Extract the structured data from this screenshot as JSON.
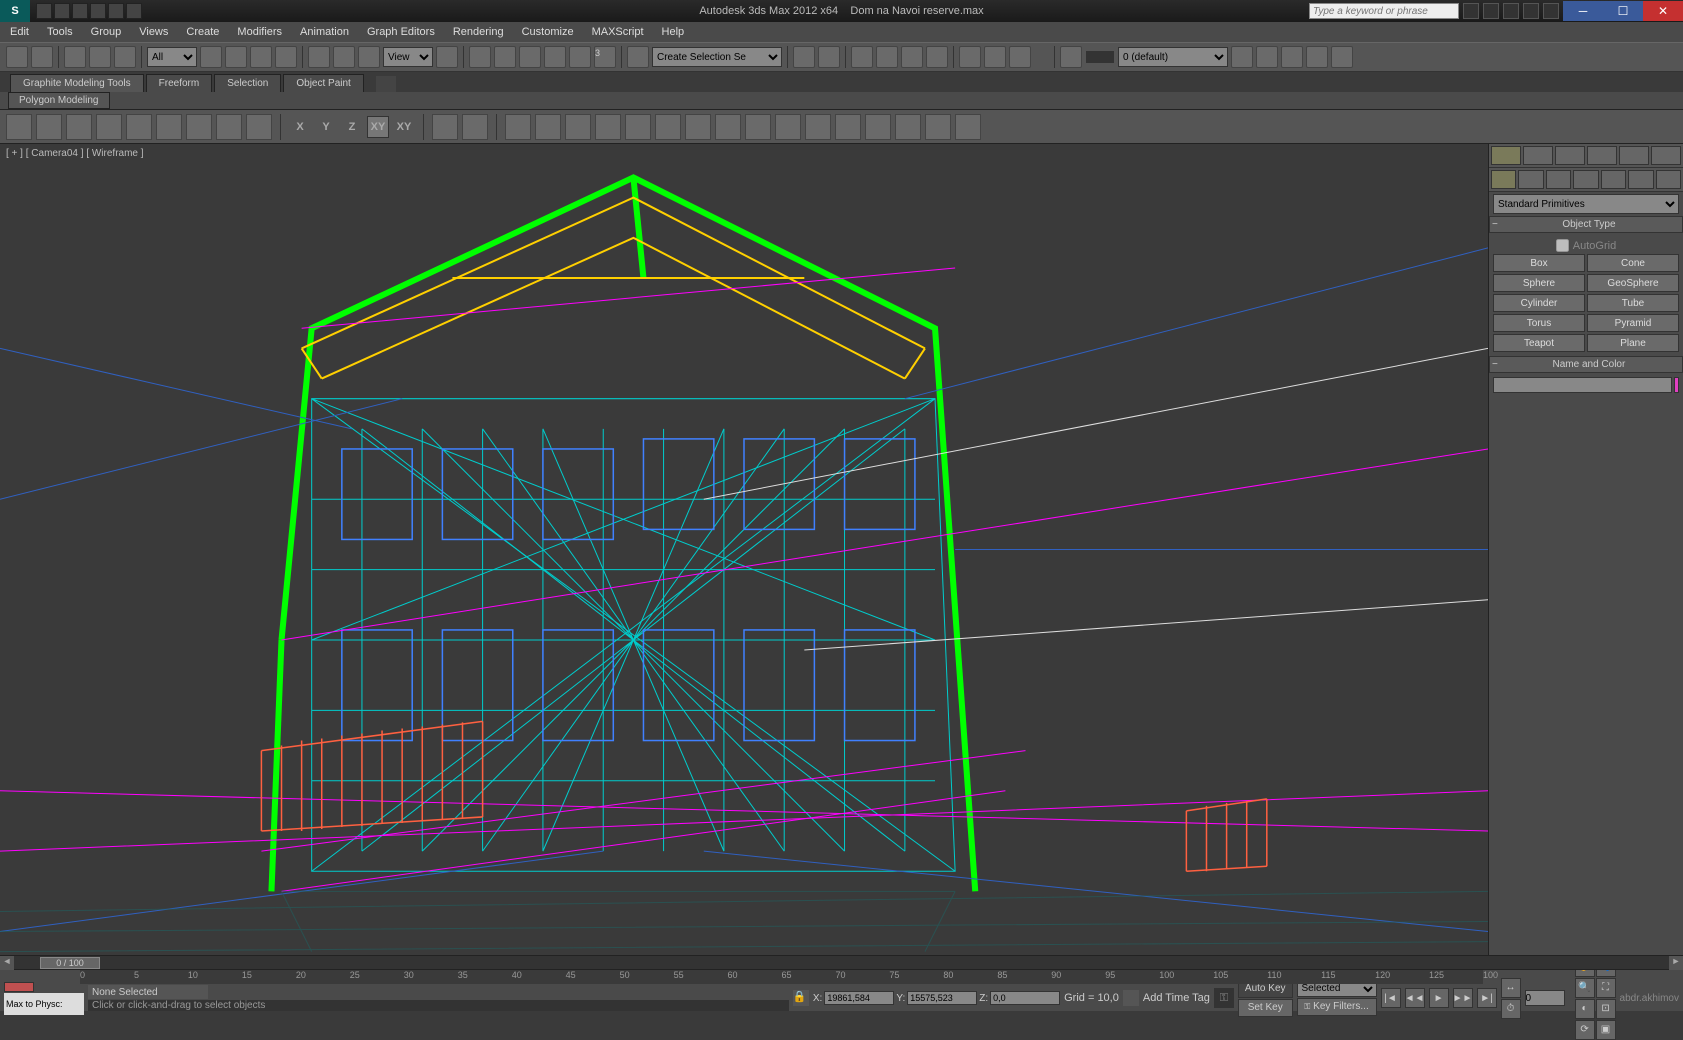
{
  "app": {
    "title": "Autodesk 3ds Max 2012 x64",
    "doc": "Dom na Navoi reserve.max",
    "search_placeholder": "Type a keyword or phrase"
  },
  "menu": [
    "Edit",
    "Tools",
    "Group",
    "Views",
    "Create",
    "Modifiers",
    "Animation",
    "Graph Editors",
    "Rendering",
    "Customize",
    "MAXScript",
    "Help"
  ],
  "main_toolbar": {
    "filter": "All",
    "view_mode": "View",
    "spinner": "3",
    "selection_set_placeholder": "Create Selection Se",
    "layer": "0 (default)"
  },
  "ribbon": {
    "tabs": [
      "Graphite Modeling Tools",
      "Freeform",
      "Selection",
      "Object Paint"
    ],
    "sub": "Polygon Modeling",
    "axes": [
      "X",
      "Y",
      "Z",
      "XY",
      "XY"
    ]
  },
  "viewport": {
    "label": "[ + ] [ Camera04 ] [ Wireframe ]"
  },
  "panel": {
    "primitive_type": "Standard Primitives",
    "object_type_header": "Object Type",
    "autogrid": "AutoGrid",
    "primitives": [
      "Box",
      "Cone",
      "Sphere",
      "GeoSphere",
      "Cylinder",
      "Tube",
      "Torus",
      "Pyramid",
      "Teapot",
      "Plane"
    ],
    "name_color_header": "Name and Color",
    "object_name": ""
  },
  "status": {
    "frame": "0 / 100",
    "ticks": [
      "0",
      "5",
      "10",
      "15",
      "20",
      "25",
      "30",
      "35",
      "40",
      "45",
      "50",
      "55",
      "60",
      "65",
      "70",
      "75",
      "80",
      "85",
      "90",
      "95",
      "100",
      "105",
      "110",
      "115",
      "120",
      "125",
      "100"
    ],
    "maxscript": "Max to Physc:",
    "selection": "None Selected",
    "prompt": "Click or click-and-drag to select objects",
    "coord_x": "19861,584",
    "coord_y": "15575,523",
    "coord_z": "0,0",
    "grid": "Grid = 10,0",
    "addtime": "Add Time Tag",
    "autokey": "Auto Key",
    "setkey": "Set Key",
    "selected": "Selected",
    "keyfilters": "Key Filters...",
    "frame_cur": "0",
    "watermark": "abdr.akhimov"
  }
}
